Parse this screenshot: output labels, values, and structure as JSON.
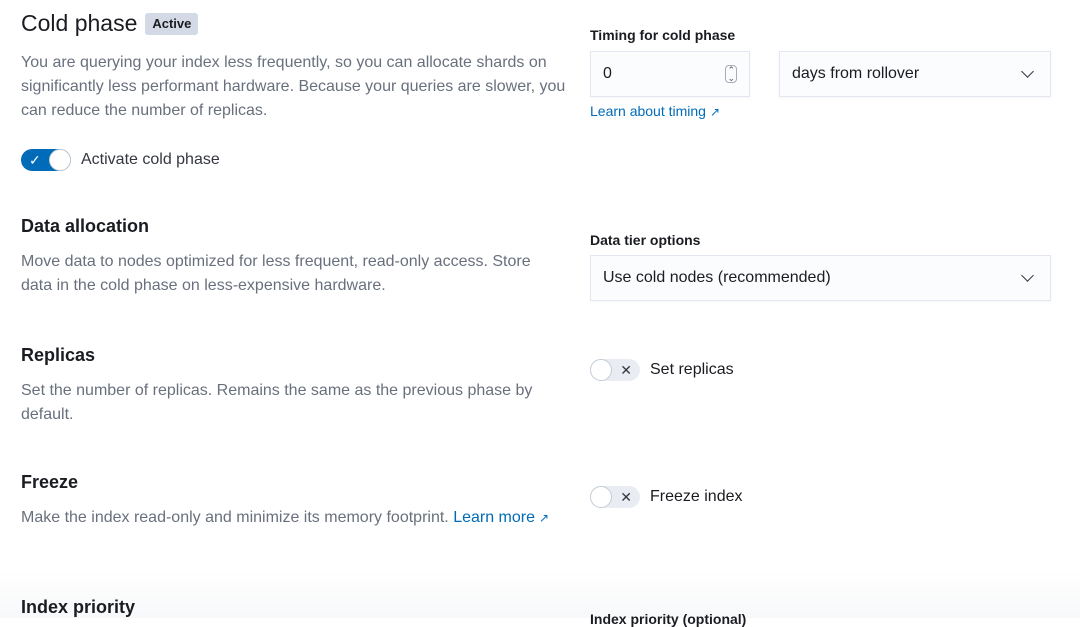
{
  "phase": {
    "title": "Cold phase",
    "badge": "Active",
    "description": "You are querying your index less frequently, so you can allocate shards on significantly less performant hardware. Because your queries are slower, you can reduce the number of replicas.",
    "activate_label": "Activate cold phase",
    "activate_on": true
  },
  "timing": {
    "label": "Timing for cold phase",
    "value": "0",
    "unit": "days from rollover",
    "learn_link": "Learn about timing"
  },
  "data_allocation": {
    "title": "Data allocation",
    "description": "Move data to nodes optimized for less frequent, read-only access. Store data in the cold phase on less-expensive hardware.",
    "tier_label": "Data tier options",
    "tier_value": "Use cold nodes (recommended)"
  },
  "replicas": {
    "title": "Replicas",
    "description": "Set the number of replicas. Remains the same as the previous phase by default.",
    "toggle_label": "Set replicas",
    "toggle_on": false
  },
  "freeze": {
    "title": "Freeze",
    "description": "Make the index read-only and minimize its memory footprint.",
    "learn_more": "Learn more",
    "toggle_label": "Freeze index",
    "toggle_on": false
  },
  "index_priority": {
    "title": "Index priority",
    "field_label": "Index priority (optional)"
  },
  "colors": {
    "accent": "#006bb8",
    "badge": "#d3dae6",
    "text_muted": "#69707d"
  }
}
